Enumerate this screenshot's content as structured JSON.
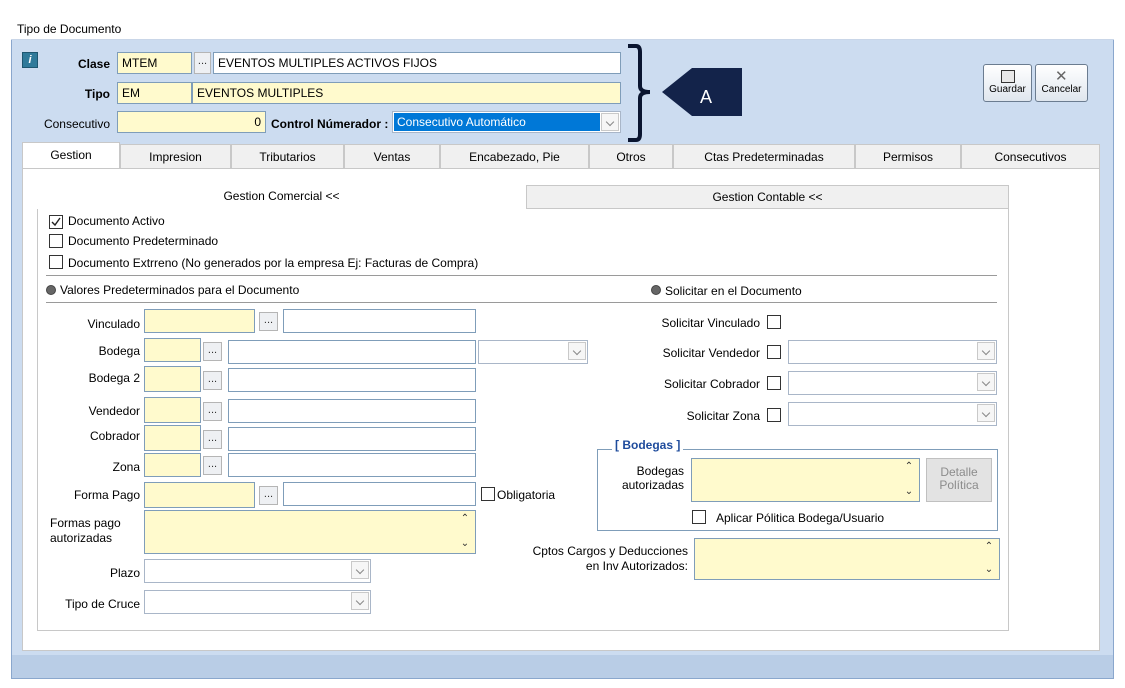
{
  "window": {
    "title": "Tipo de Documento"
  },
  "header": {
    "clase_label": "Clase",
    "clase_code": "MTEM",
    "clase_desc": "EVENTOS MULTIPLES ACTIVOS FIJOS",
    "tipo_label": "Tipo",
    "tipo_code": "EM",
    "tipo_desc": "EVENTOS MULTIPLES",
    "consecutivo_label": "Consecutivo",
    "consecutivo_value": "0",
    "control_label": "Control Númerador :",
    "control_value": "Consecutivo Automático",
    "callout_letter": "A",
    "dots": "..."
  },
  "toolbar": {
    "save_label": "Guardar",
    "cancel_label": "Cancelar"
  },
  "tabs": [
    "Gestion",
    "Impresion",
    "Tributarios",
    "Ventas",
    "Encabezado, Pie",
    "Otros",
    "Ctas Predeterminadas",
    "Permisos",
    "Consecutivos"
  ],
  "subtabs": {
    "comercial": "Gestion Comercial <<",
    "contable": "Gestion Contable <<"
  },
  "checks": {
    "activo": "Documento Activo",
    "activo_checked": true,
    "predeterminado": "Documento Predeterminado",
    "externo": "Documento Extrreno (No generados por la empresa  Ej: Facturas de Compra)"
  },
  "sections": {
    "valores": "Valores Predeterminados para el Documento",
    "solicitar": "Solicitar en el Documento"
  },
  "left_fields": {
    "vinculado": "Vinculado",
    "bodega": "Bodega",
    "bodega2": "Bodega 2",
    "vendedor": "Vendedor",
    "cobrador": "Cobrador",
    "zona": "Zona",
    "forma_pago": "Forma Pago",
    "obligatoria": "Obligatoria",
    "formas_pago_aut": "Formas pago autorizadas",
    "plazo": "Plazo",
    "tipo_cruce": "Tipo de Cruce"
  },
  "right_fields": {
    "sol_vinculado": "Solicitar Vinculado",
    "sol_vendedor": "Solicitar Vendedor",
    "sol_cobrador": "Solicitar Cobrador",
    "sol_zona": "Solicitar Zona",
    "bodegas_group": "[ Bodegas ]",
    "bodegas_aut": "Bodegas autorizadas",
    "detalle_politica": "Detalle Política",
    "aplicar_politica": "Aplicar Pólitica Bodega/Usuario",
    "cptos": "Cptos Cargos y Deducciones en Inv Autorizados:"
  },
  "colors": {
    "window_bg": "#ccdcf0",
    "yellow_field": "#fffacd",
    "selected_blue": "#0078d7",
    "callout": "#13234a",
    "group_title": "#1e4b9c"
  }
}
